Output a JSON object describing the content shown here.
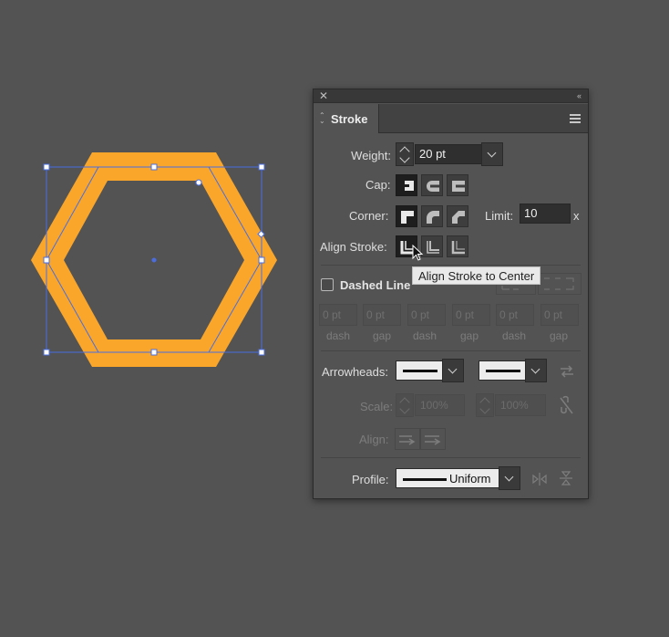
{
  "panel": {
    "title": "Stroke",
    "weight_label": "Weight:",
    "weight_value": "20 pt",
    "cap_label": "Cap:",
    "corner_label": "Corner:",
    "limit_label": "Limit:",
    "limit_value": "10",
    "limit_unit": "x",
    "align_label": "Align Stroke:",
    "tooltip": "Align Stroke to Center",
    "dashed_label": "Dashed Line",
    "dash_values": [
      "0 pt",
      "0 pt",
      "0 pt",
      "0 pt",
      "0 pt",
      "0 pt"
    ],
    "dash_labels": [
      "dash",
      "gap",
      "dash",
      "gap",
      "dash",
      "gap"
    ],
    "arrowheads_label": "Arrowheads:",
    "scale_label": "Scale:",
    "scale_values": [
      "100%",
      "100%"
    ],
    "align_arrow_label": "Align:",
    "profile_label": "Profile:",
    "profile_value": "Uniform"
  },
  "colors": {
    "canvas_bg": "#535353",
    "shape_stroke": "#f9a62b",
    "selection": "#4a6ee0"
  },
  "icons": [
    "close-icon",
    "collapse-icon",
    "menu-icon",
    "cap-butt-icon",
    "cap-round-icon",
    "cap-projecting-icon",
    "corner-miter-icon",
    "corner-round-icon",
    "corner-bevel-icon",
    "align-center-icon",
    "align-inside-icon",
    "align-outside-icon",
    "swap-arrows-icon",
    "link-scale-icon",
    "flip-axis-icon",
    "flip-along-icon",
    "cursor-icon"
  ]
}
